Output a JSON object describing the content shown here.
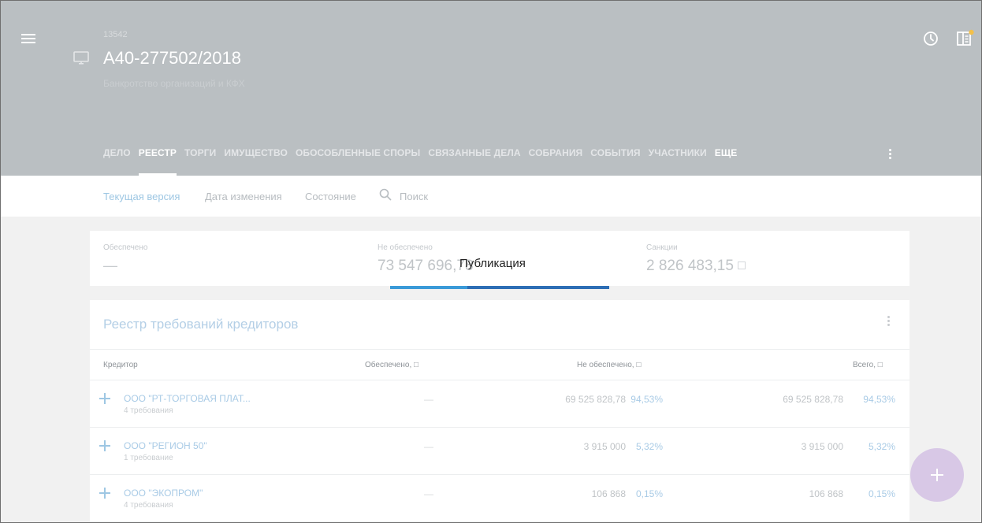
{
  "header": {
    "case_number": "13542",
    "case_title": "А40-277502/2018",
    "case_subtitle": "Банкротство организаций и КФХ",
    "background": "#babfc2"
  },
  "tabs": [
    {
      "label": "ДЕЛО",
      "active": false
    },
    {
      "label": "РЕЕСТР",
      "active": true
    },
    {
      "label": "ТОРГИ",
      "active": false
    },
    {
      "label": "ИМУЩЕСТВО",
      "active": false
    },
    {
      "label": "ОБОСОБЛЕННЫЕ СПОРЫ",
      "active": false
    },
    {
      "label": "СВЯЗАННЫЕ ДЕЛА",
      "active": false
    },
    {
      "label": "СОБРАНИЯ",
      "active": false
    },
    {
      "label": "СОБЫТИЯ",
      "active": false
    },
    {
      "label": "УЧАСТНИКИ",
      "active": false
    },
    {
      "label": "ЕЩЕ",
      "active": false
    }
  ],
  "filters": {
    "current_version": "Текущая версия",
    "change_date": "Дата изменения",
    "state": "Состояние",
    "search_placeholder": "Поиск"
  },
  "summary": {
    "secured_label": "Обеспечено",
    "secured_value": "—",
    "unsecured_label": "Не обеспечено",
    "unsecured_value": "73 547 696,78",
    "sanctions_label": "Санкции",
    "sanctions_value": "2 826 483,15"
  },
  "tooltip": "Публикация",
  "registry": {
    "title": "Реестр требований кредиторов",
    "columns": {
      "creditor": "Кредитор",
      "secured": "Обеспечено, □",
      "unsecured": "Не обеспечено, □",
      "total": "Всего, □"
    },
    "rows": [
      {
        "name": "ООО \"РТ-ТОРГОВАЯ ПЛАТ...",
        "claims": "4 требования",
        "secured": "—",
        "unsecured": "69 525 828,78",
        "unsecured_pct": "94,53%",
        "total": "69 525 828,78",
        "total_pct": "94,53%"
      },
      {
        "name": "ООО \"РЕГИОН 50\"",
        "claims": "1 требование",
        "secured": "—",
        "unsecured": "3 915 000",
        "unsecured_pct": "5,32%",
        "total": "3 915 000",
        "total_pct": "5,32%"
      },
      {
        "name": "ООО \"ЭКОПРОМ\"",
        "claims": "4 требования",
        "secured": "—",
        "unsecured": "106 868",
        "unsecured_pct": "0,15%",
        "total": "106 868",
        "total_pct": "0,15%"
      }
    ]
  },
  "colors": {
    "accent": "#3a9ad8",
    "accent_dark": "#2d6eb5",
    "fab": "#d8c8e6"
  }
}
